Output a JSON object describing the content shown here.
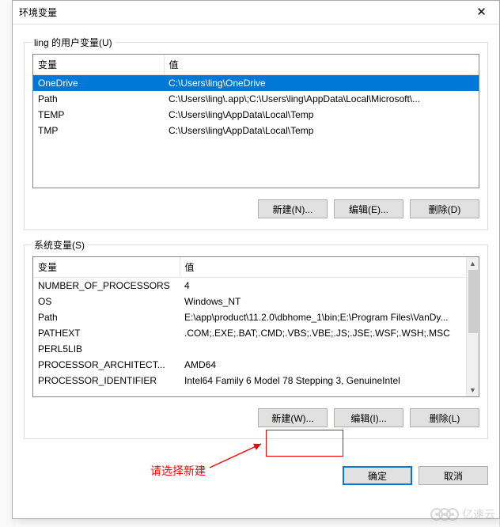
{
  "dialog": {
    "title": "环境变量",
    "close": "✕"
  },
  "user_group": {
    "label": "ling 的用户变量(U)",
    "headers": {
      "var": "变量",
      "val": "值"
    },
    "rows": [
      {
        "var": "OneDrive",
        "val": "C:\\Users\\ling\\OneDrive",
        "selected": true
      },
      {
        "var": "Path",
        "val": "C:\\Users\\ling\\.app\\;C:\\Users\\ling\\AppData\\Local\\Microsoft\\...",
        "selected": false
      },
      {
        "var": "TEMP",
        "val": "C:\\Users\\ling\\AppData\\Local\\Temp",
        "selected": false
      },
      {
        "var": "TMP",
        "val": "C:\\Users\\ling\\AppData\\Local\\Temp",
        "selected": false
      }
    ],
    "buttons": {
      "new": "新建(N)...",
      "edit": "编辑(E)...",
      "delete": "删除(D)"
    }
  },
  "sys_group": {
    "label": "系统变量(S)",
    "headers": {
      "var": "变量",
      "val": "值"
    },
    "rows": [
      {
        "var": "NUMBER_OF_PROCESSORS",
        "val": "4"
      },
      {
        "var": "OS",
        "val": "Windows_NT"
      },
      {
        "var": "Path",
        "val": "E:\\app\\product\\11.2.0\\dbhome_1\\bin;E:\\Program Files\\VanDy..."
      },
      {
        "var": "PATHEXT",
        "val": ".COM;.EXE;.BAT;.CMD;.VBS;.VBE;.JS;.JSE;.WSF;.WSH;.MSC"
      },
      {
        "var": "PERL5LIB",
        "val": ""
      },
      {
        "var": "PROCESSOR_ARCHITECT...",
        "val": "AMD64"
      },
      {
        "var": "PROCESSOR_IDENTIFIER",
        "val": "Intel64 Family 6 Model 78 Stepping 3, GenuineIntel"
      }
    ],
    "buttons": {
      "new": "新建(W)...",
      "edit": "编辑(I)...",
      "delete": "删除(L)"
    }
  },
  "footer": {
    "ok": "确定",
    "cancel": "取消"
  },
  "annotation": {
    "text": "请选择新建"
  },
  "watermark": {
    "text": "亿速云"
  }
}
